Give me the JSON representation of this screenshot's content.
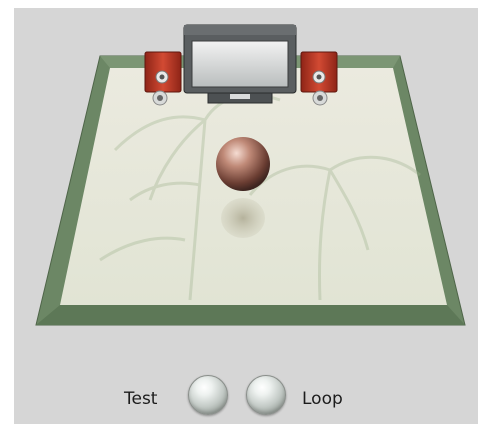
{
  "controls": {
    "test_label": "Test",
    "loop_label": "Loop"
  },
  "icons": {
    "test": "round-glossy-button",
    "loop": "round-glossy-button",
    "monitor": "crt-monitor-icon",
    "speaker": "red-speaker-icon",
    "listener": "sphere-listener-icon"
  },
  "colors": {
    "background": "#d6d6d6",
    "floor_border": "#6f8a68",
    "speaker_red": "#c0392b"
  }
}
